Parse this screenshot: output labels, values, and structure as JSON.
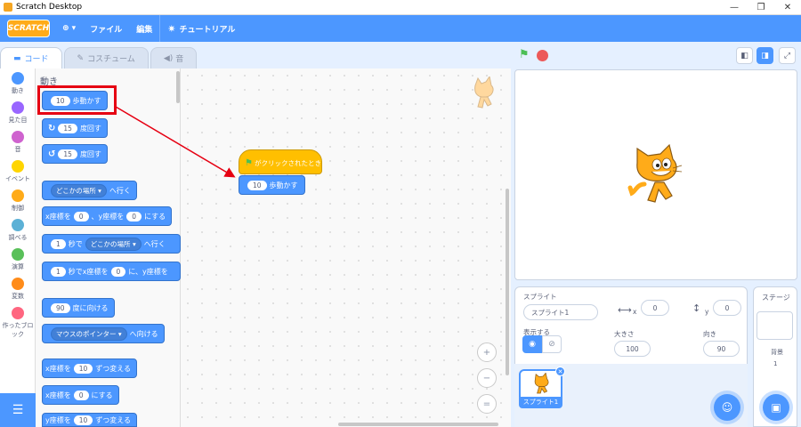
{
  "window": {
    "title": "Scratch Desktop",
    "minimize": "—",
    "restore": "❐",
    "close": "✕"
  },
  "menubar": {
    "logo": "SCRATCH",
    "language_icon": "⊕ ▾",
    "file": "ファイル",
    "edit": "編集",
    "tutorial": "チュートリアル"
  },
  "tabs": [
    {
      "label": "コード"
    },
    {
      "label": "コスチューム"
    },
    {
      "label": "音"
    }
  ],
  "categories": [
    {
      "label": "動き",
      "color": "#4c97ff"
    },
    {
      "label": "見た目",
      "color": "#9966ff"
    },
    {
      "label": "音",
      "color": "#cf63cf"
    },
    {
      "label": "イベント",
      "color": "#ffd500"
    },
    {
      "label": "制御",
      "color": "#ffab19"
    },
    {
      "label": "調べる",
      "color": "#5cb1d6"
    },
    {
      "label": "演算",
      "color": "#59c059"
    },
    {
      "label": "変数",
      "color": "#ff8c1a"
    },
    {
      "label": "作ったブロック",
      "color": "#ff6680"
    }
  ],
  "palette": {
    "heading": "動き",
    "move": {
      "value": "10",
      "text": "歩動かす"
    },
    "turn_right": {
      "icon": "↻",
      "value": "15",
      "text": "度回す"
    },
    "turn_left": {
      "icon": "↺",
      "value": "15",
      "text": "度回す"
    },
    "goto": {
      "dropdown": "どこかの場所 ▾",
      "text": "へ行く"
    },
    "goto_xy": {
      "t1": "x座標を",
      "x": "0",
      "t2": "、y座標を",
      "y": "0",
      "t3": "にする"
    },
    "glide": {
      "value": "1",
      "t1": "秒で",
      "dropdown": "どこかの場所 ▾",
      "t2": "へ行く"
    },
    "glide_xy": {
      "value": "1",
      "t1": "秒でx座標を",
      "x": "0",
      "t2": "に、y座標を"
    },
    "point": {
      "value": "90",
      "text": "度に向ける"
    },
    "point_towards": {
      "dropdown": "マウスのポインター ▾",
      "text": "へ向ける"
    },
    "change_x": {
      "t1": "x座標を",
      "value": "10",
      "t2": "ずつ変える"
    },
    "set_x": {
      "t1": "x座標を",
      "value": "0",
      "t2": "にする"
    },
    "change_y": {
      "t1": "y座標を",
      "value": "10",
      "t2": "ずつ変える"
    }
  },
  "script": {
    "hat_text": "がクリックされたとき",
    "move_value": "10",
    "move_text": "歩動かす"
  },
  "zoom": {
    "in": "+",
    "out": "−",
    "reset": "="
  },
  "sprite": {
    "label": "スプライト",
    "name": "スプライト1",
    "x_label": "x",
    "x": "0",
    "y_label": "y",
    "y": "0",
    "show_label": "表示する",
    "size_label": "大きさ",
    "size": "100",
    "direction_label": "向き",
    "direction": "90",
    "thumb_name": "スプライト1"
  },
  "stage_pane": {
    "title": "ステージ",
    "backdrop_label": "背景",
    "backdrop_count": "1"
  },
  "accent_colors": {
    "blue": "#4c97ff",
    "yellow": "#ffbf00",
    "red_highlight": "#e60012",
    "green_flag": "#4cbf56",
    "stop": "#ec5959"
  }
}
